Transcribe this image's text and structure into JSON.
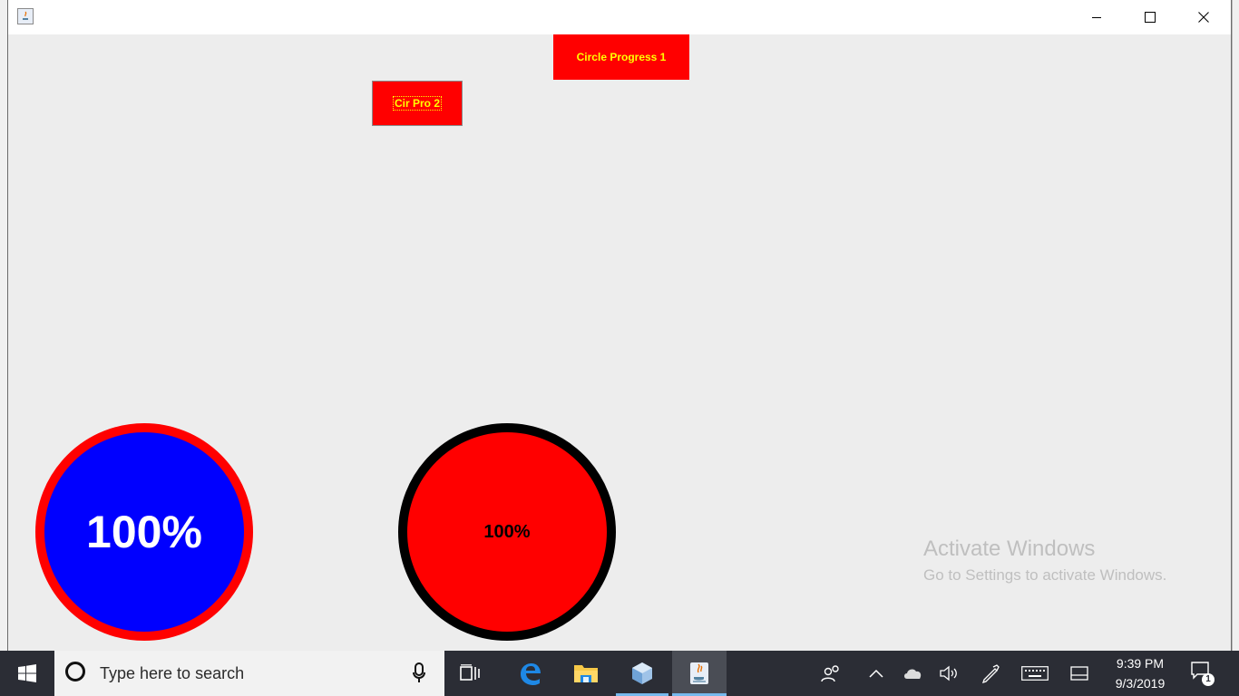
{
  "window": {
    "buttons": {
      "minimize": "minimize-icon",
      "maximize": "maximize-icon",
      "close": "close-icon"
    }
  },
  "content": {
    "button_circle_progress_1": "Circle Progress 1",
    "button_cir_pro_2": "Cir Pro 2",
    "circle_1": {
      "label": "100%",
      "fill": "#0000ff",
      "ring": "#ff0000",
      "text_color": "#ffffff"
    },
    "circle_2": {
      "label": "100%",
      "fill": "#ff0000",
      "ring": "#000000",
      "text_color": "#000000"
    },
    "button_color": "#ff0000",
    "button_text_color": "#ffff00"
  },
  "watermark": {
    "title": "Activate Windows",
    "subtitle": "Go to Settings to activate Windows."
  },
  "taskbar": {
    "search_placeholder": "Type here to search",
    "pinned": [
      "task-view-icon",
      "edge-icon",
      "file-explorer-icon",
      "virtualbox-icon",
      "java-icon"
    ],
    "time": "9:39 PM",
    "date": "9/3/2019",
    "notification_count": "1"
  }
}
